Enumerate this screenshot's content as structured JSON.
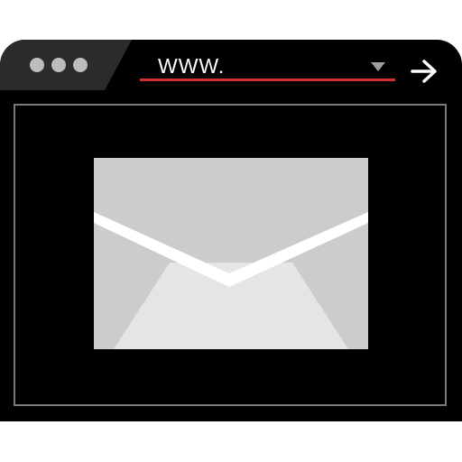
{
  "browser": {
    "window_controls": [
      "dot",
      "dot",
      "dot"
    ],
    "address_bar": {
      "value": "WWW.",
      "underline_color": "#d32f2f",
      "dropdown_icon": "chevron-down-icon"
    },
    "go_icon": "arrow-right-icon"
  },
  "content": {
    "icon": "envelope-icon"
  },
  "colors": {
    "window": "#000000",
    "tab": "#2b2b2b",
    "frame_border": "#7a7a7a",
    "accent": "#d32f2f",
    "envelope_back": "#cccccc",
    "envelope_front": "#e5e5e5",
    "envelope_flap_edge": "#ffffff"
  }
}
